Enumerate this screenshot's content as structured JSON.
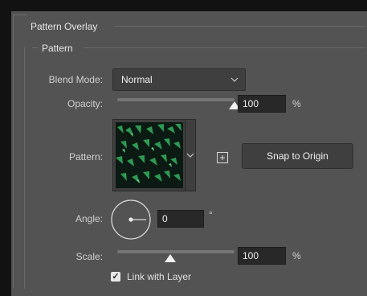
{
  "section": {
    "title": "Pattern Overlay",
    "subtitle": "Pattern"
  },
  "blend_mode": {
    "label": "Blend Mode:",
    "value": "Normal",
    "chevron_icon": "chevron-down-icon"
  },
  "opacity": {
    "label": "Opacity:",
    "value": "100",
    "unit": "%",
    "level": 1.0
  },
  "pattern": {
    "label": "Pattern:",
    "swatch_icon": "leaf-pattern-thumbnail",
    "picker_chevron_icon": "chevron-down-icon",
    "new_preset_icon": "plus-square-icon",
    "new_preset_symbol": "+",
    "snap_button": "Snap to Origin"
  },
  "angle": {
    "label": "Angle:",
    "value": "0",
    "unit": "°",
    "dial_degrees": 0
  },
  "scale": {
    "label": "Scale:",
    "value": "100",
    "unit": "%",
    "level": 0.45
  },
  "link": {
    "label": "Link with Layer",
    "checked": true,
    "check_mark": "✓"
  },
  "colors": {
    "panel_bg": "#535353",
    "outer_bg": "#121212",
    "field_bg": "#282828",
    "control_bg": "#3f3f3f",
    "text": "#d6d6d6",
    "pattern_dark": "#0b1a12",
    "pattern_leaf": "#2f9a55"
  }
}
